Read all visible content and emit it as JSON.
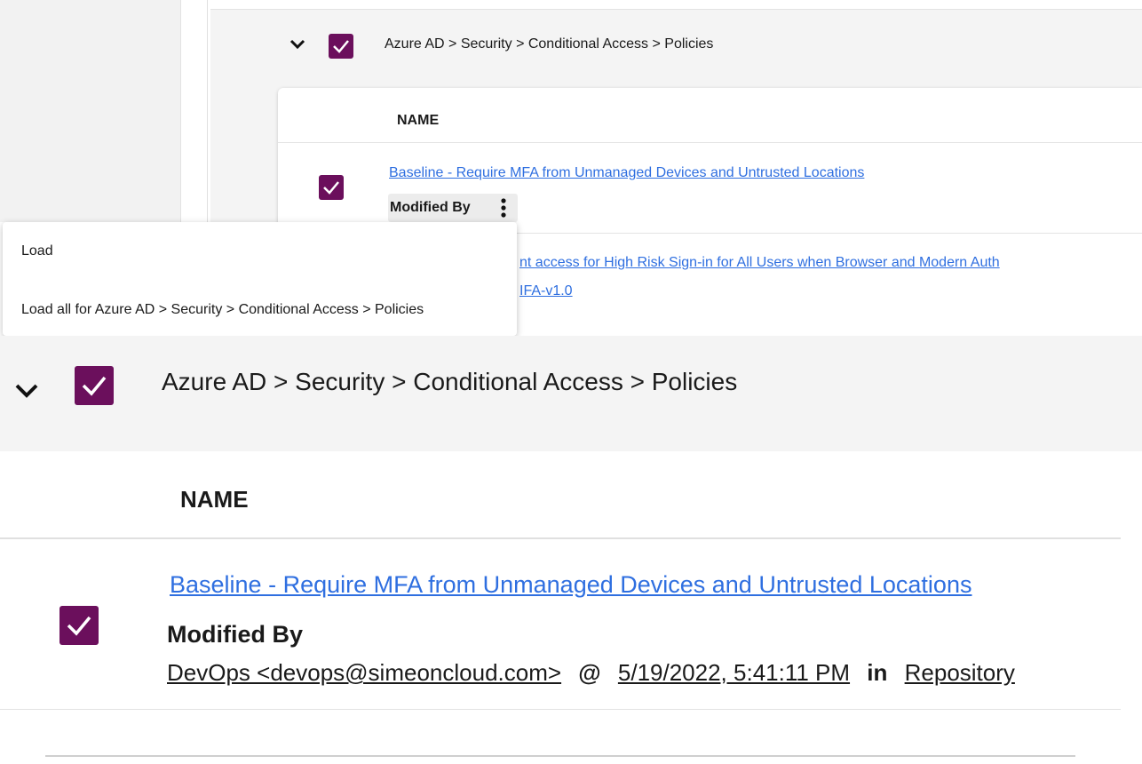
{
  "top_panel": {
    "group_title": "Azure AD > Security > Conditional Access > Policies",
    "column_header": "NAME",
    "rows": [
      {
        "name": "Baseline - Require MFA from Unmanaged Devices and Untrusted Locations",
        "modified_by_label": "Modified By"
      },
      {
        "name_visible_line1": "nt access for High Risk Sign-in for All Users when Browser and Modern Auth",
        "name_visible_line2": "IFA-v1.0"
      }
    ]
  },
  "context_menu": {
    "items": [
      {
        "label": "Load"
      },
      {
        "label": "Load all for Azure AD > Security > Conditional Access > Policies"
      }
    ]
  },
  "bottom_panel": {
    "group_title": "Azure AD > Security > Conditional Access > Policies",
    "column_header": "NAME",
    "row": {
      "name": "Baseline - Require MFA from Unmanaged Devices and Untrusted Locations",
      "modified_by_label": "Modified By",
      "modified_by_user": "DevOps <devops@simeoncloud.com>",
      "at_word": "@",
      "timestamp": "5/19/2022, 5:41:11 PM",
      "in_word": "in",
      "location": "Repository"
    }
  },
  "colors": {
    "checkbox": "#6b0f5c",
    "link": "#2f6fe0",
    "header_bg": "#f4f4f4"
  },
  "icons": [
    "chevron-down-icon",
    "checkmark-icon",
    "kebab-menu-icon"
  ]
}
